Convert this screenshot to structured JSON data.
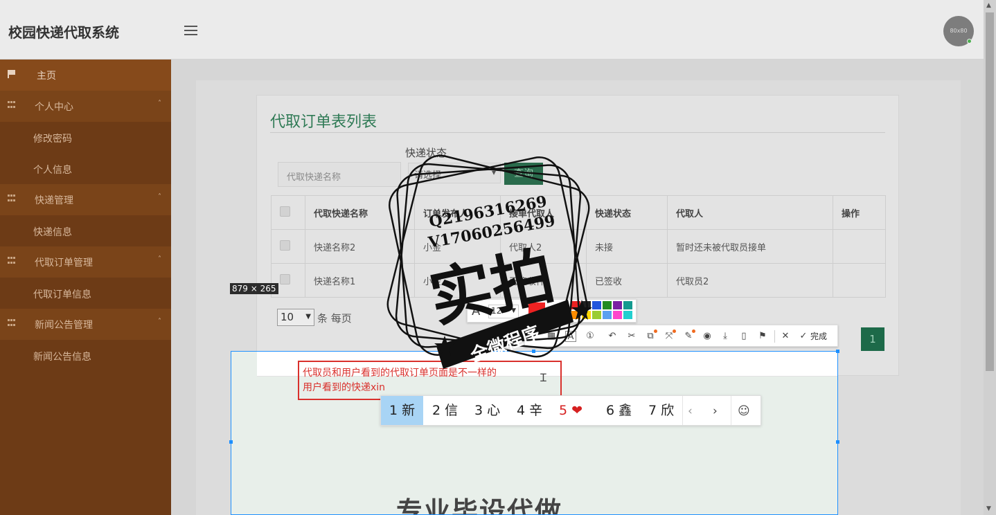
{
  "app": {
    "title": "校园快递代取系统",
    "avatar_text": "80x80"
  },
  "sidebar": {
    "home": "主页",
    "groups": [
      {
        "label": "个人中心",
        "items": [
          "修改密码",
          "个人信息"
        ]
      },
      {
        "label": "快递管理",
        "items": [
          "快递信息"
        ]
      },
      {
        "label": "代取订单管理",
        "items": [
          "代取订单信息"
        ]
      },
      {
        "label": "新闻公告管理",
        "items": [
          "新闻公告信息"
        ]
      }
    ]
  },
  "main": {
    "card_title": "代取订单表列表",
    "search_placeholder": "代取快递名称",
    "status_label": "快递状态",
    "status_select": "请选择",
    "query_button": "查询",
    "columns": [
      "代取快递名称",
      "订单发布人",
      "接单代取人",
      "快递状态",
      "代取人",
      "操作"
    ],
    "rows": [
      [
        "快递名称2",
        "小金",
        "代取人2",
        "未接",
        "暂时还未被代取员接单",
        ""
      ],
      [
        "快递名称1",
        "小金",
        "已签收件",
        "已签收",
        "代取员2",
        ""
      ]
    ],
    "page_size": "10",
    "page_size_suffix": "条 每页",
    "current_page": "1"
  },
  "overlay": {
    "dimensions": "879 × 265",
    "annotation_line1": "代取员和用户看到的代取订单页面是不一样的",
    "annotation_line2": "用户看到的快递xin",
    "toolbar_done": "完成",
    "font_size": "12",
    "selection_headline": "专业毕设代做",
    "ime_candidates": [
      "1 新",
      "2 信",
      "3 心",
      "4 辛",
      "5 ❤",
      "6 鑫",
      "7 欣"
    ],
    "font_colors": [
      "#ee2222",
      "#222222",
      "#2255dd",
      "#228b22",
      "#7a1fa2",
      "#139a8f",
      "#ff8c00",
      "#ffd700",
      "#9acd32",
      "#5aa0f0",
      "#ff44cc",
      "#22cfcf"
    ]
  },
  "watermark": {
    "line1": "Q2196316269",
    "line2": "V17060256499",
    "big": "实拍",
    "ribbon": "全微程序"
  }
}
